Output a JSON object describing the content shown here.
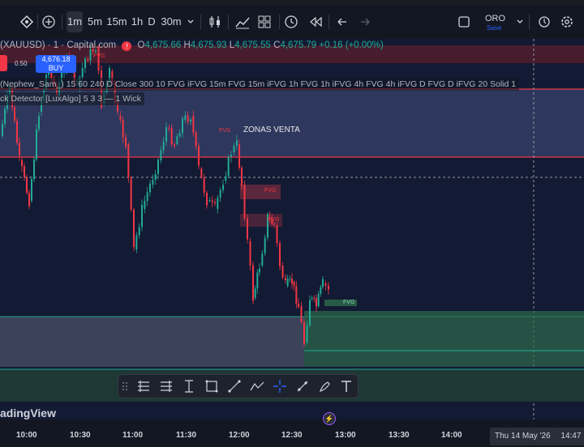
{
  "toolbar": {
    "intervals": [
      "1m",
      "5m",
      "15m",
      "1h",
      "D",
      "30m"
    ],
    "symbol_label": "ORO",
    "symbol_sub": "Save"
  },
  "legend": {
    "symbol": "(XAUUSD) · 1 · Capital.com",
    "open_label": "O",
    "open": "4,675.66",
    "high_label": "H",
    "high": "4,675.93",
    "low_label": "L",
    "low": "4,675.55",
    "close_label": "C",
    "close": "4,675.79",
    "change": "+0.16 (+0.00%)"
  },
  "trade": {
    "spread": "0.50",
    "buy_price": "4,676.18",
    "buy_label": "BUY"
  },
  "indicators": [
    "(Nephew_Sam_) 15 60 240 D Close 300 10 FVG iFVG 15m FVG 15m iFVG 1h FVG 1h iFVG 4h FVG 4h iFVG D FVG D iFVG 20 Solid 1",
    "ck Detector [LuxAlgo] 5 3 3 — 1 Wick"
  ],
  "labels": {
    "fvg": "FVG",
    "zonas": "ZONAS VENTA",
    "watermark": "adingView"
  },
  "xaxis": {
    "ticks": [
      "10:00",
      "10:30",
      "11:00",
      "11:30",
      "12:00",
      "12:30",
      "13:00",
      "13:30",
      "14:00"
    ],
    "date_label": "Thu 14 May '26",
    "time_label": "14:47"
  },
  "colors": {
    "bull": "#22ab94",
    "bear": "#f23645",
    "accent": "#2962ff"
  },
  "icons": [
    "compare-icon",
    "add-icon",
    "candle-type-icon",
    "indicators-icon",
    "templates-icon",
    "alert-icon",
    "replay-icon",
    "undo-icon",
    "redo-icon",
    "fullscreen-icon",
    "settings-icon",
    "lightning-icon"
  ]
}
